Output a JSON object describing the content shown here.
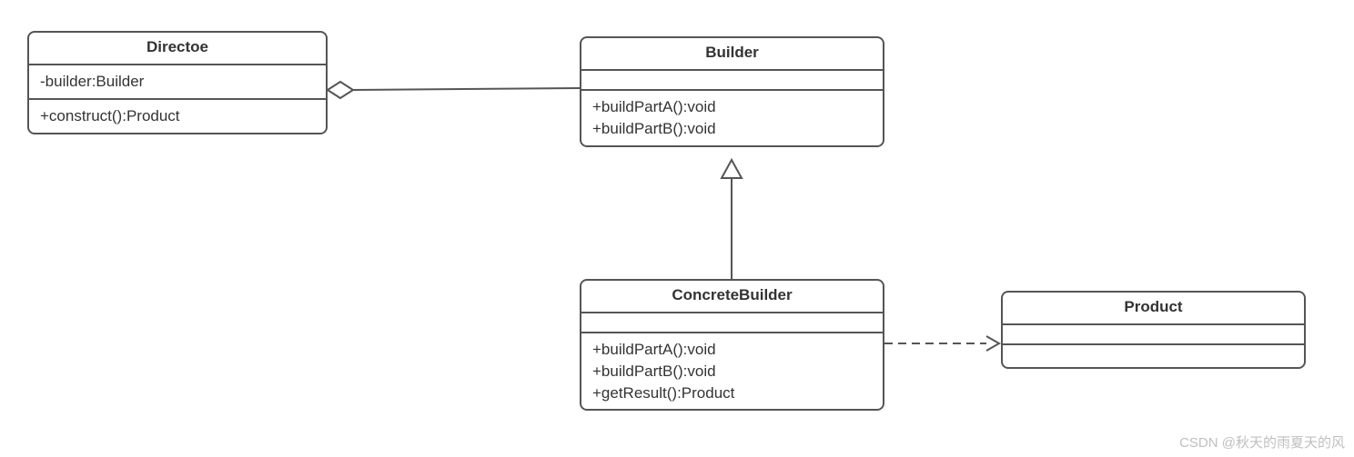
{
  "classes": {
    "director": {
      "name": "Directoe",
      "attrs": [
        "-builder:Builder"
      ],
      "ops": [
        "+construct():Product"
      ]
    },
    "builder": {
      "name": "Builder",
      "attrs": [],
      "ops": [
        "+buildPartA():void",
        "+buildPartB():void"
      ]
    },
    "concrete": {
      "name": "ConcreteBuilder",
      "attrs": [],
      "ops": [
        "+buildPartA():void",
        "+buildPartB():void",
        "+getResult():Product"
      ]
    },
    "product": {
      "name": "Product",
      "attrs": [],
      "ops": []
    }
  },
  "relations": [
    {
      "from": "director",
      "to": "builder",
      "type": "aggregation"
    },
    {
      "from": "concrete",
      "to": "builder",
      "type": "generalization"
    },
    {
      "from": "concrete",
      "to": "product",
      "type": "dependency"
    }
  ],
  "watermark": "CSDN @秋天的雨夏天的风"
}
